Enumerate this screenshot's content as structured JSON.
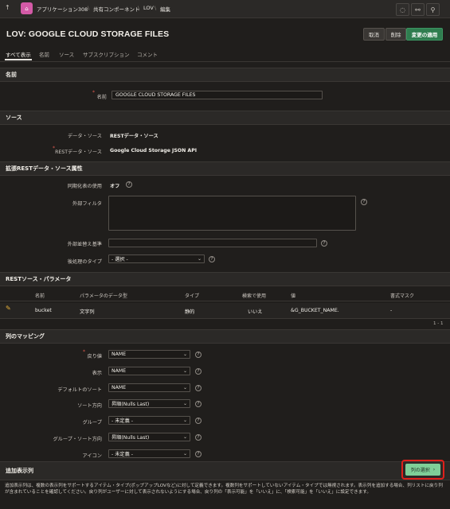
{
  "topbar": {
    "breadcrumbs": [
      "アプリケーション308",
      "共有コンポーネント",
      "LOV",
      "編集"
    ]
  },
  "header": {
    "title": "LOV: GOOGLE CLOUD STORAGE FILES",
    "cancel_label": "取消",
    "delete_label": "削除",
    "apply_label": "変更の適用"
  },
  "tabs": [
    "すべて表示",
    "名前",
    "ソース",
    "サブスクリプション",
    "コメント"
  ],
  "sections": {
    "name": {
      "title": "名前",
      "name_label": "名前",
      "name_value": "GOOGLE CLOUD STORAGE FILES"
    },
    "source": {
      "title": "ソース",
      "data_source_label": "データ・ソース",
      "data_source_value": "RESTデータ・ソース",
      "rest_source_label": "RESTデータ・ソース",
      "rest_source_value": "Google Cloud Storage JSON API"
    },
    "advanced": {
      "title": "拡張RESTデータ・ソース属性",
      "sync_label": "同期化表の使用",
      "sync_value": "オフ",
      "external_filter_label": "外部フィルタ",
      "external_order_label": "外部並替え基準",
      "post_processing_label": "後処理のタイプ",
      "post_processing_value": "- 選択 -"
    },
    "params": {
      "title": "RESTソース・パラメータ",
      "headers": [
        "名前",
        "パラメータのデータ型",
        "タイプ",
        "検索で使用",
        "値",
        "書式マスク"
      ],
      "row": [
        "bucket",
        "文字列",
        "静的",
        "いいえ",
        "&G_BUCKET_NAME.",
        "-"
      ],
      "pagination": "1 - 1"
    },
    "mapping": {
      "title": "列のマッピング",
      "fields": [
        {
          "label": "戻り値",
          "value": "NAME",
          "required": true
        },
        {
          "label": "表示",
          "value": "NAME",
          "required": false
        },
        {
          "label": "デフォルトのソート",
          "value": "NAME",
          "required": false
        },
        {
          "label": "ソート方向",
          "value": "昇順(Nulls Last)",
          "required": false
        },
        {
          "label": "グループ",
          "value": "- 未定義 -",
          "required": false
        },
        {
          "label": "グループ・ソート方向",
          "value": "昇順(Nulls Last)",
          "required": false
        },
        {
          "label": "アイコン",
          "value": "- 未定義 -",
          "required": false
        }
      ]
    },
    "additional": {
      "title": "追加表示列",
      "select_columns_label": "列の選択",
      "description": "追加表示列は、複数の表示列をサポートするアイテム・タイプ(ポップアップLOVなど)に対して定義できます。複数列をサポートしていないアイテム・タイプでは無視されます。表示列を追加する場合、列リストに戻り列が含まれていることを確認してください。戻り列がユーザーに対して表示されないようにする場合、戻り列の「表示可能」を「いいえ」に、「検索可能」を「いいえ」に設定できます。"
    }
  },
  "colors": {
    "background": "#201e1c",
    "accent_green": "#2f7d4f",
    "highlight_red": "#e0201b"
  }
}
